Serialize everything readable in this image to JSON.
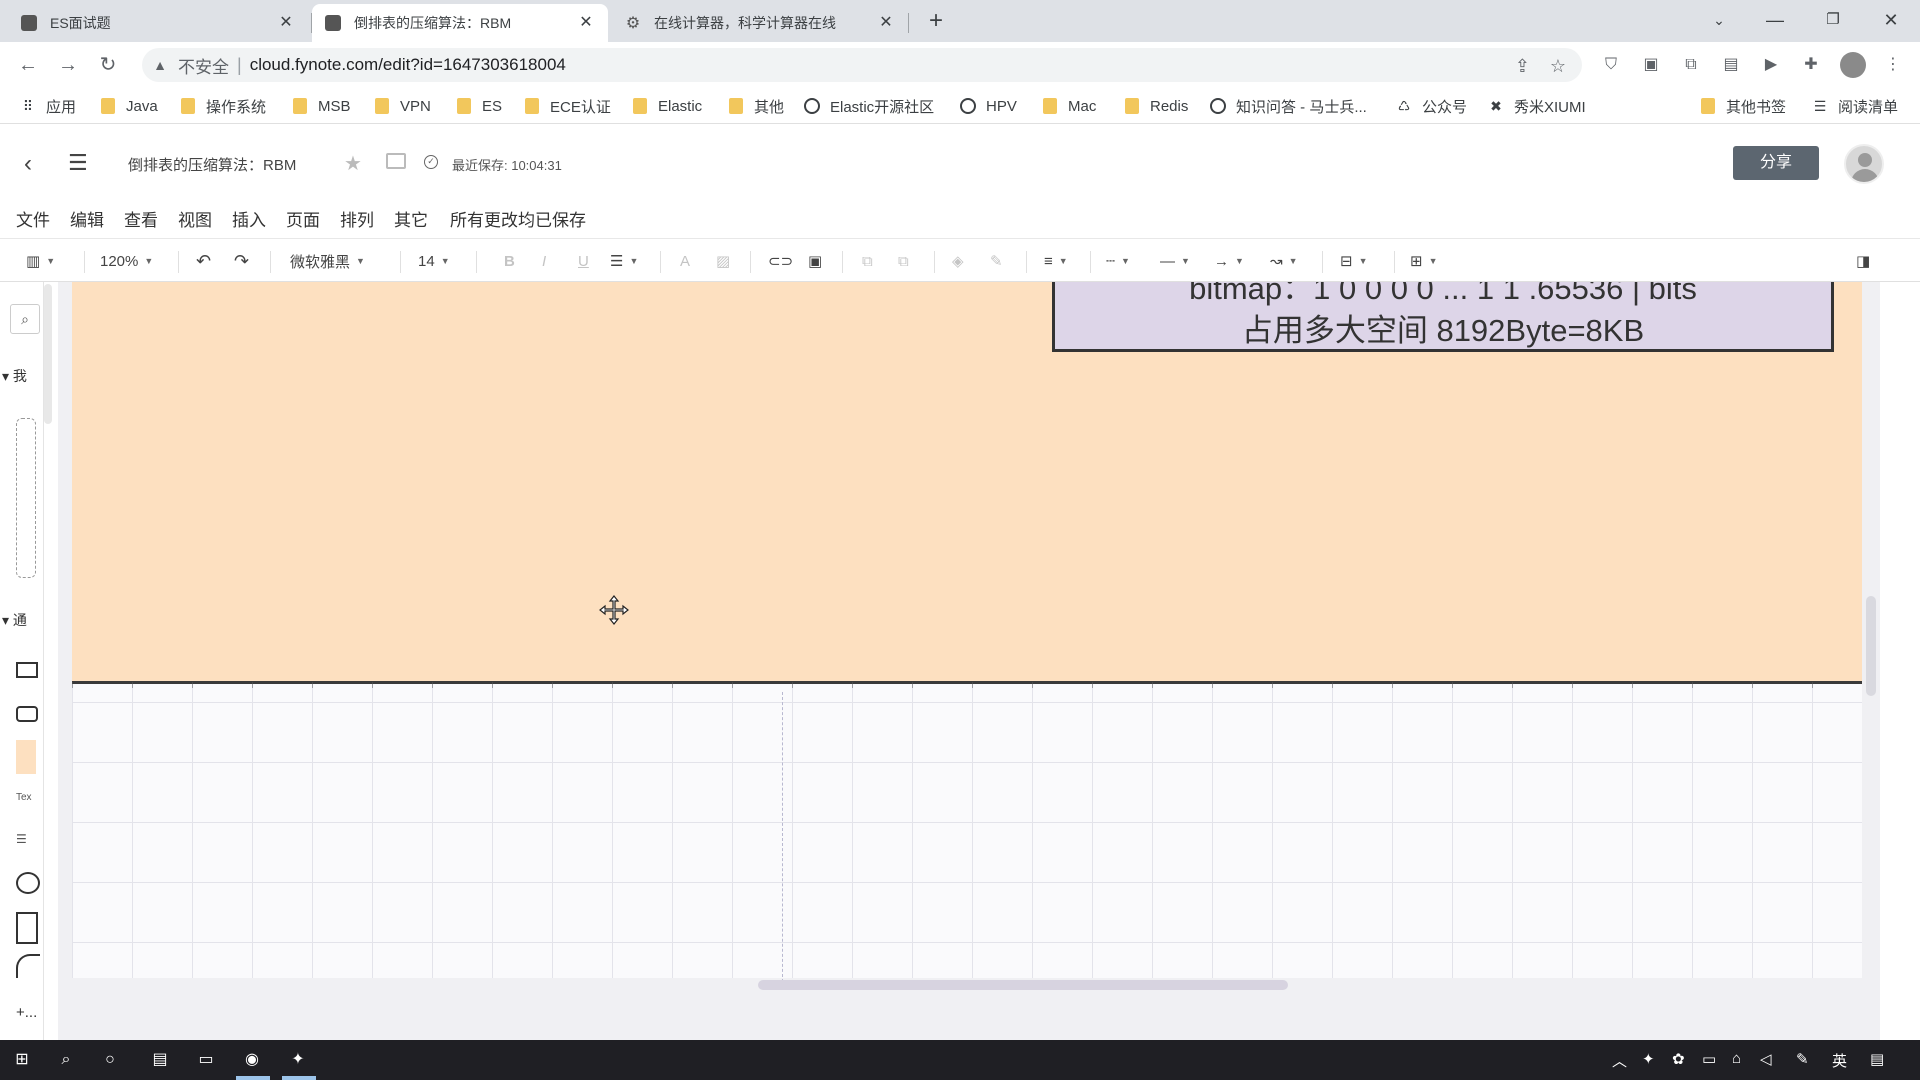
{
  "browser": {
    "tabs": [
      {
        "title": "ES面试题",
        "active": false
      },
      {
        "title": "倒排表的压缩算法：RBM",
        "active": true
      },
      {
        "title": "在线计算器，科学计算器在线",
        "active": false
      }
    ],
    "address": {
      "security_label": "不安全",
      "url": "cloud.fynote.com/edit?id=1647303618004"
    },
    "bookmarks": [
      {
        "label": "应用",
        "icon": "apps-grid-icon"
      },
      {
        "label": "Java",
        "icon": "folder-icon"
      },
      {
        "label": "操作系统",
        "icon": "folder-icon"
      },
      {
        "label": "MSB",
        "icon": "folder-icon"
      },
      {
        "label": "VPN",
        "icon": "folder-icon"
      },
      {
        "label": "ES",
        "icon": "folder-icon"
      },
      {
        "label": "ECE认证",
        "icon": "folder-icon"
      },
      {
        "label": "Elastic",
        "icon": "folder-icon"
      },
      {
        "label": "其他",
        "icon": "folder-icon"
      },
      {
        "label": "Elastic开源社区",
        "icon": "globe-icon"
      },
      {
        "label": "HPV",
        "icon": "globe-icon"
      },
      {
        "label": "Mac",
        "icon": "folder-icon"
      },
      {
        "label": "Redis",
        "icon": "folder-icon"
      },
      {
        "label": "知识问答 - 马士兵...",
        "icon": "site-icon"
      },
      {
        "label": "公众号",
        "icon": "site-icon"
      },
      {
        "label": "秀米XIUMI",
        "icon": "site-icon"
      },
      {
        "label": "其他书签",
        "icon": "folder-icon"
      },
      {
        "label": "阅读清单",
        "icon": "reading-list-icon"
      }
    ]
  },
  "app": {
    "doc_title": "倒排表的压缩算法：RBM",
    "saved_text": "最近保存: 10:04:31",
    "share_label": "分享",
    "menus": [
      "文件",
      "编辑",
      "查看",
      "视图",
      "插入",
      "页面",
      "排列",
      "其它",
      "所有更改均已保存"
    ],
    "toolbar": {
      "zoom": "120%",
      "font": "微软雅黑",
      "font_size": "14"
    },
    "left_panel": {
      "group1": "我",
      "group2": "通",
      "text_shape_label": "Tex",
      "more_label": "+..."
    }
  },
  "canvas": {
    "textbox_line1": "bitmap：1 0 0 0 0 ... 1 1      .65536 | bits",
    "textbox_line2": "占用多大空间 8192Byte=8KB",
    "colors": {
      "peach_fill": "#fde0c0",
      "textbox_fill": "#ddd5e8"
    }
  },
  "taskbar": {
    "ime_label": "英"
  }
}
